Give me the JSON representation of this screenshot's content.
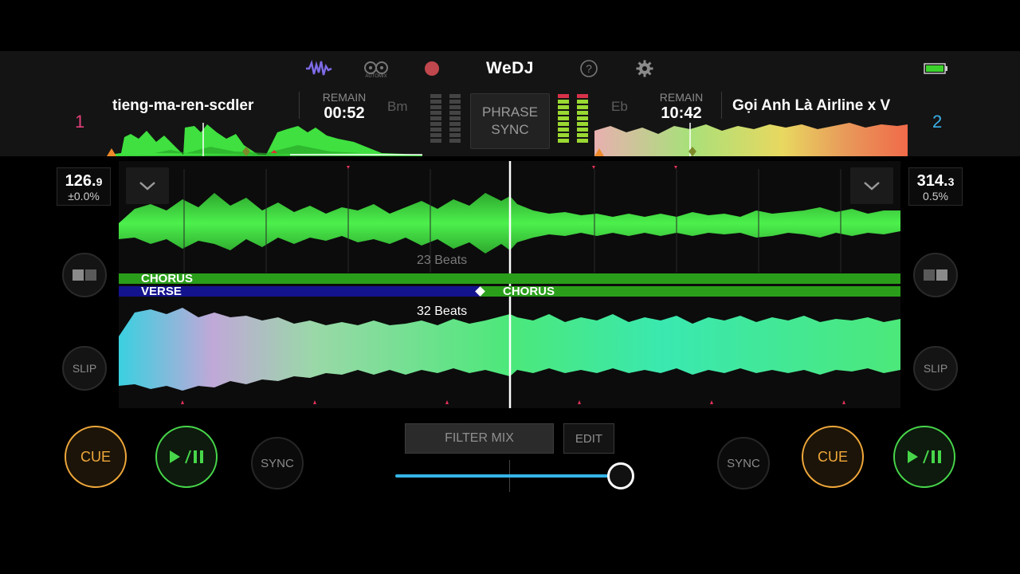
{
  "app": {
    "logo": "WeDJ",
    "automix_label": "AUTOMIX"
  },
  "toolbar": {
    "icons": [
      "waveform-icon",
      "automix-icon",
      "record-icon",
      "help-icon",
      "settings-icon",
      "battery-icon"
    ],
    "record_color": "#c0474d",
    "waveform_icon_color": "#7d6be8",
    "battery_color": "#3bd22b"
  },
  "deck1": {
    "number": "1",
    "number_color": "#e0407a",
    "track": "tieng-ma-ren-scdler",
    "remain_label": "REMAIN",
    "remain": "00:52",
    "key": "Bm",
    "bpm_int": "126.",
    "bpm_dec": "9",
    "pitch": "±0.0%",
    "cue_label": "CUE",
    "sync_label": "SYNC",
    "slip_label": "SLIP"
  },
  "deck2": {
    "number": "2",
    "number_color": "#3ab0e8",
    "track": "Gọi Anh Là Airline x V",
    "remain_label": "REMAIN",
    "remain": "10:42",
    "key": "Eb",
    "bpm_int": "314.",
    "bpm_dec": "3",
    "pitch": "0.5%",
    "cue_label": "CUE",
    "sync_label": "SYNC",
    "slip_label": "SLIP"
  },
  "center": {
    "phrase_sync_line1": "PHRASE",
    "phrase_sync_line2": "SYNC"
  },
  "waveform": {
    "top_beats": "23 Beats",
    "bottom_beats": "32 Beats",
    "deck1_phrase_label": "CHORUS",
    "deck2_phrase_left": "VERSE",
    "deck2_phrase_right": "CHORUS",
    "chorus_color": "#2a9e1a",
    "verse_color": "#14138e"
  },
  "mixer": {
    "filter_mix_label": "FILTER MIX",
    "edit_label": "EDIT",
    "crossfader_position": 0.85
  }
}
